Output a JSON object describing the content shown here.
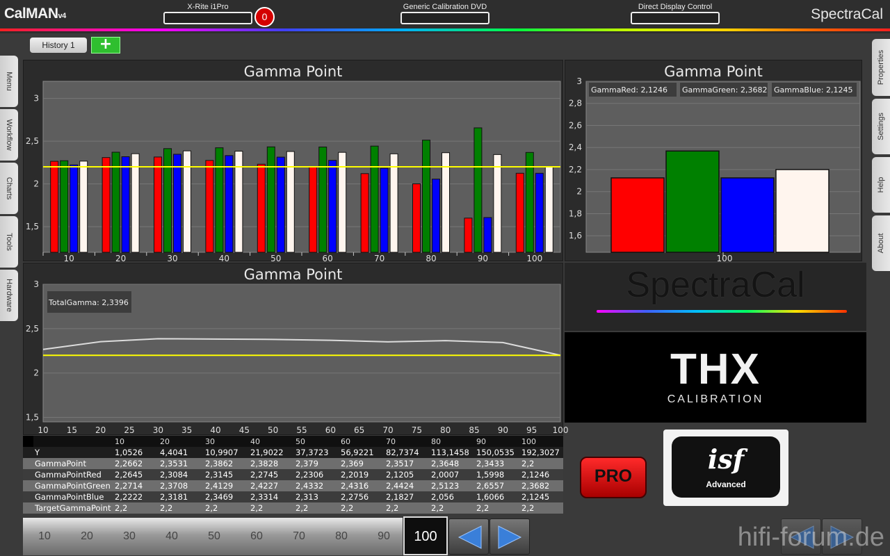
{
  "header": {
    "logo": "CalMAN",
    "logo_version": "v4",
    "meter_label": "X-Rite i1Pro",
    "meter_badge": "0",
    "source_label": "Generic Calibration DVD",
    "display_label": "Direct Display Control",
    "vendor_logo": "SpectraCal"
  },
  "history": {
    "tab_label": "History 1",
    "add_icon": "plus-icon"
  },
  "left_tabs": [
    "Menu",
    "Workflow",
    "Charts",
    "Tools",
    "Hardware"
  ],
  "right_tabs": [
    "Properties",
    "Settings",
    "Help",
    "About"
  ],
  "colors": {
    "red": "#ff0000",
    "green": "#008000",
    "blue": "#0000ff",
    "white": "#fff5ee",
    "target": "#ffff00",
    "accent": "#2fbf2f"
  },
  "logos": {
    "spectracal": "SpectraCal",
    "thx": "THX",
    "thx_sub": "CALIBRATION",
    "pro": "PRO",
    "isf": "isf",
    "isf_sub": "Advanced",
    "watermark": "hifi-forum.de"
  },
  "chart_data": [
    {
      "type": "bar",
      "title": "Gamma Point",
      "categories": [
        "10",
        "20",
        "30",
        "40",
        "50",
        "60",
        "70",
        "80",
        "90",
        "100"
      ],
      "series": [
        {
          "name": "GammaPointRed",
          "values": [
            2.2645,
            2.3084,
            2.3145,
            2.2745,
            2.2306,
            2.2019,
            2.1205,
            2.0007,
            1.5998,
            2.1246
          ]
        },
        {
          "name": "GammaPointGreen",
          "values": [
            2.2714,
            2.3708,
            2.4129,
            2.4227,
            2.4332,
            2.4316,
            2.4424,
            2.5123,
            2.6557,
            2.3682
          ]
        },
        {
          "name": "GammaPointBlue",
          "values": [
            2.2222,
            2.3181,
            2.3469,
            2.3314,
            2.313,
            2.2756,
            2.1827,
            2.056,
            1.6066,
            2.1245
          ]
        },
        {
          "name": "GammaPoint",
          "values": [
            2.2662,
            2.3531,
            2.3862,
            2.3828,
            2.379,
            2.369,
            2.3517,
            2.3648,
            2.3433,
            2.2
          ]
        }
      ],
      "target": 2.2,
      "ylim": [
        1.2,
        3.2
      ],
      "yticks": [
        "1,5",
        "2",
        "2,5",
        "3"
      ]
    },
    {
      "type": "bar",
      "title": "Gamma Point",
      "categories": [
        "100"
      ],
      "series": [
        {
          "name": "GammaRed",
          "values": [
            2.1246
          ]
        },
        {
          "name": "GammaGreen",
          "values": [
            2.3682
          ]
        },
        {
          "name": "GammaBlue",
          "values": [
            2.1245
          ]
        },
        {
          "name": "Gamma",
          "values": [
            2.2
          ]
        }
      ],
      "ylim": [
        1.45,
        3.0
      ],
      "yticks": [
        "1,6",
        "1,8",
        "2",
        "2,2",
        "2,4",
        "2,6",
        "2,8",
        "3"
      ],
      "legend": [
        "GammaRed: 2,1246",
        "GammaGreen: 2,3682",
        "GammaBlue: 2,1245"
      ]
    },
    {
      "type": "line",
      "title": "Gamma Point",
      "x": [
        10,
        20,
        30,
        40,
        50,
        60,
        70,
        80,
        90,
        100
      ],
      "series": [
        {
          "name": "TotalGamma",
          "values": [
            2.2662,
            2.3531,
            2.3862,
            2.3828,
            2.379,
            2.369,
            2.3517,
            2.3648,
            2.3433,
            2.2
          ]
        },
        {
          "name": "TargetGamma",
          "values": [
            2.2,
            2.2,
            2.2,
            2.2,
            2.2,
            2.2,
            2.2,
            2.2,
            2.2,
            2.2
          ]
        }
      ],
      "xlim": [
        10,
        100
      ],
      "ylim": [
        1.45,
        3.0
      ],
      "xticks": [
        "10",
        "15",
        "20",
        "25",
        "30",
        "35",
        "40",
        "45",
        "50",
        "55",
        "60",
        "65",
        "70",
        "75",
        "80",
        "85",
        "90",
        "95",
        "100"
      ],
      "yticks": [
        "1,5",
        "2",
        "2,5",
        "3"
      ],
      "annotation": "TotalGamma: 2,3396"
    }
  ],
  "table": {
    "columns": [
      "10",
      "20",
      "30",
      "40",
      "50",
      "60",
      "70",
      "80",
      "90",
      "100"
    ],
    "rows": [
      {
        "label": "Y",
        "values": [
          "1,0526",
          "4,4041",
          "10,9907",
          "21,9022",
          "37,3723",
          "56,9221",
          "82,7374",
          "113,1458",
          "150,0535",
          "192,3027"
        ]
      },
      {
        "label": "GammaPoint",
        "values": [
          "2,2662",
          "2,3531",
          "2,3862",
          "2,3828",
          "2,379",
          "2,369",
          "2,3517",
          "2,3648",
          "2,3433",
          "2,2"
        ]
      },
      {
        "label": "GammaPointRed",
        "values": [
          "2,2645",
          "2,3084",
          "2,3145",
          "2,2745",
          "2,2306",
          "2,2019",
          "2,1205",
          "2,0007",
          "1,5998",
          "2,1246"
        ]
      },
      {
        "label": "GammaPointGreen",
        "values": [
          "2,2714",
          "2,3708",
          "2,4129",
          "2,4227",
          "2,4332",
          "2,4316",
          "2,4424",
          "2,5123",
          "2,6557",
          "2,3682"
        ]
      },
      {
        "label": "GammaPointBlue",
        "values": [
          "2,2222",
          "2,3181",
          "2,3469",
          "2,3314",
          "2,313",
          "2,2756",
          "2,1827",
          "2,056",
          "1,6066",
          "2,1245"
        ]
      },
      {
        "label": "TargetGammaPoint",
        "values": [
          "2,2",
          "2,2",
          "2,2",
          "2,2",
          "2,2",
          "2,2",
          "2,2",
          "2,2",
          "2,2",
          "2,2"
        ]
      }
    ]
  },
  "nav": {
    "points": [
      "10",
      "20",
      "30",
      "40",
      "50",
      "60",
      "70",
      "80",
      "90"
    ],
    "current": "100"
  }
}
